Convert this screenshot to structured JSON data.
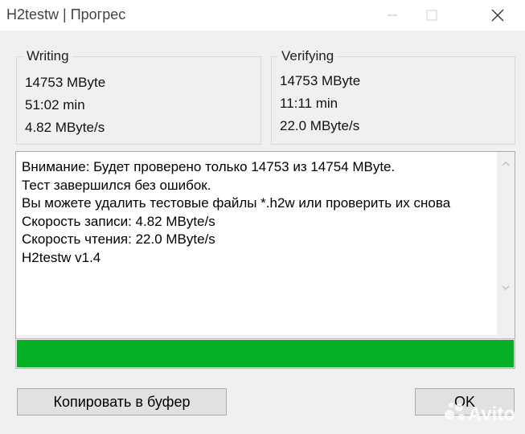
{
  "window": {
    "title": "H2testw | Прогрес",
    "minimize_icon": "minimize-icon",
    "maximize_icon": "maximize-icon",
    "close_icon": "close-icon"
  },
  "writing": {
    "legend": "Writing",
    "amount": "14753 MByte",
    "time": "51:02 min",
    "speed": "4.82 MByte/s"
  },
  "verifying": {
    "legend": "Verifying",
    "amount": "14753 MByte",
    "time": "11:11 min",
    "speed": "22.0 MByte/s"
  },
  "log": {
    "lines": [
      "Внимание: Будет проверено только 14753 из 14754 MByte.",
      "Тест завершился без ошибок.",
      "Вы можете удалить тестовые файлы *.h2w или проверить их снова",
      "Скорость записи: 4.82 MByte/s",
      "Скорость чтения: 22.0 MByte/s",
      "H2testw v1.4"
    ]
  },
  "progress": {
    "percent": 100,
    "color": "#06b025"
  },
  "buttons": {
    "copy_label": "Копировать в буфер",
    "ok_label": "OK"
  },
  "watermark": {
    "text": "Avito"
  }
}
